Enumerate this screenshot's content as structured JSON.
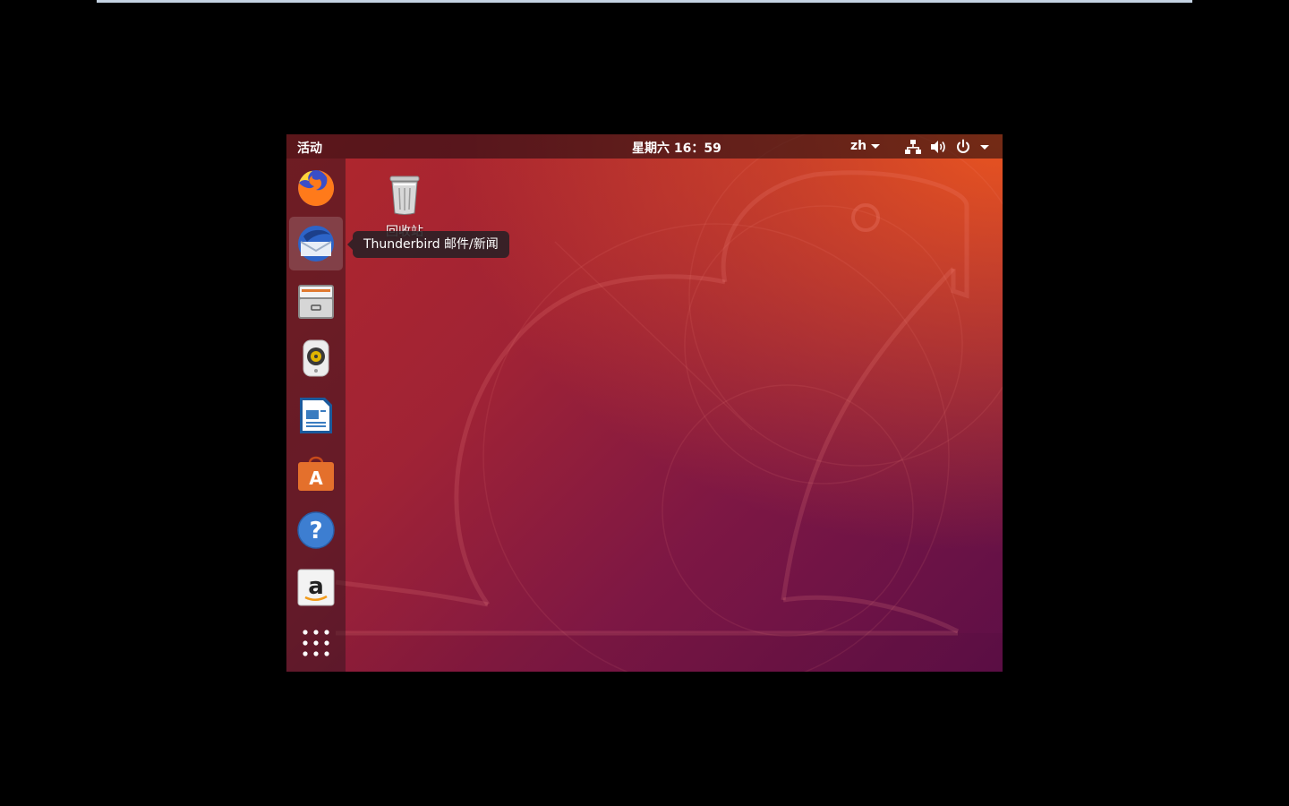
{
  "top_bar": {
    "activities_label": "活动",
    "clock": "星期六 16：59",
    "input_method": "zh",
    "tray_icons": [
      "network-icon",
      "volume-icon",
      "power-icon",
      "system-menu-arrow"
    ]
  },
  "dock": {
    "items": [
      {
        "name": "Firefox",
        "icon": "firefox-icon",
        "active": false
      },
      {
        "name": "Thunderbird 邮件/新闻",
        "icon": "thunderbird-icon",
        "active": true
      },
      {
        "name": "Files",
        "icon": "files-icon",
        "active": false
      },
      {
        "name": "Rhythmbox",
        "icon": "rhythmbox-icon",
        "active": false
      },
      {
        "name": "LibreOffice Writer",
        "icon": "writer-icon",
        "active": false
      },
      {
        "name": "Ubuntu Software",
        "icon": "software-icon",
        "active": false
      },
      {
        "name": "Help",
        "icon": "help-icon",
        "active": false
      },
      {
        "name": "Amazon",
        "icon": "amazon-icon",
        "active": false
      },
      {
        "name": "Show Applications",
        "icon": "app-grid-icon",
        "active": false
      }
    ]
  },
  "desktop": {
    "trash_label": "回收站"
  },
  "tooltip": {
    "text": "Thunderbird 邮件/新闻"
  },
  "colors": {
    "wallpaper_orange": "#e95420",
    "wallpaper_aubergine": "#5e0f47",
    "topbar": "#2c1a1e"
  }
}
